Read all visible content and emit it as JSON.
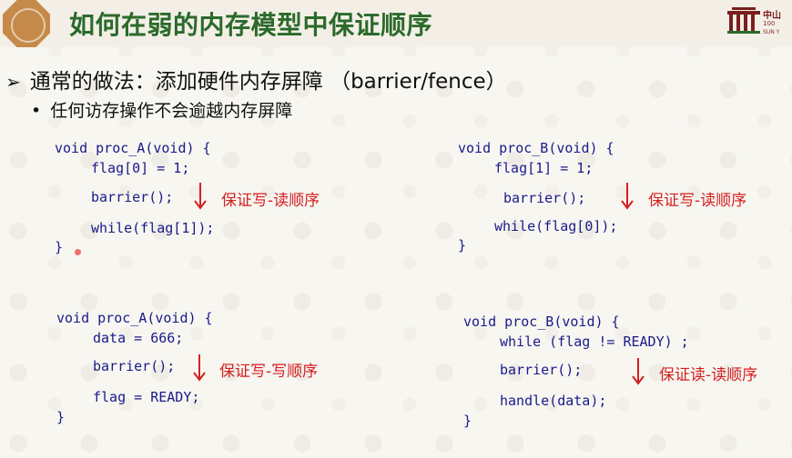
{
  "header": {
    "title": "如何在弱的内存模型中保证顺序",
    "logo": {
      "text1": "中山",
      "text2": "100",
      "text3": "SUN Y"
    }
  },
  "bullets": {
    "main": "通常的做法：添加硬件内存屏障 （barrier/fence）",
    "sub": "任何访存操作不会逾越内存屏障",
    "main_marker": "➢",
    "sub_marker": "•"
  },
  "code_blocks": [
    {
      "id": "proc-a-1",
      "lines": [
        "void proc_A(void) {",
        "flag[0] = 1;",
        "barrier();",
        "while(flag[1]);",
        "}"
      ],
      "label": "保证写-读顺序"
    },
    {
      "id": "proc-b-1",
      "lines": [
        "void proc_B(void) {",
        "flag[1] = 1;",
        "barrier();",
        "while(flag[0]);",
        "}"
      ],
      "label": "保证写-读顺序"
    },
    {
      "id": "proc-a-2",
      "lines": [
        "void proc_A(void) {",
        "data = 666;",
        "barrier();",
        "flag = READY;",
        "}"
      ],
      "label": "保证写-写顺序"
    },
    {
      "id": "proc-b-2",
      "lines": [
        "void proc_B(void) {",
        "while (flag != READY) ;",
        "barrier();",
        "handle(data);",
        "}"
      ],
      "label": "保证读-读顺序"
    }
  ],
  "colors": {
    "title": "#2b6a2b",
    "code": "#1a1a8a",
    "keyword": "#8a1aa8",
    "number": "#0a7a0a",
    "label": "#d42020"
  }
}
